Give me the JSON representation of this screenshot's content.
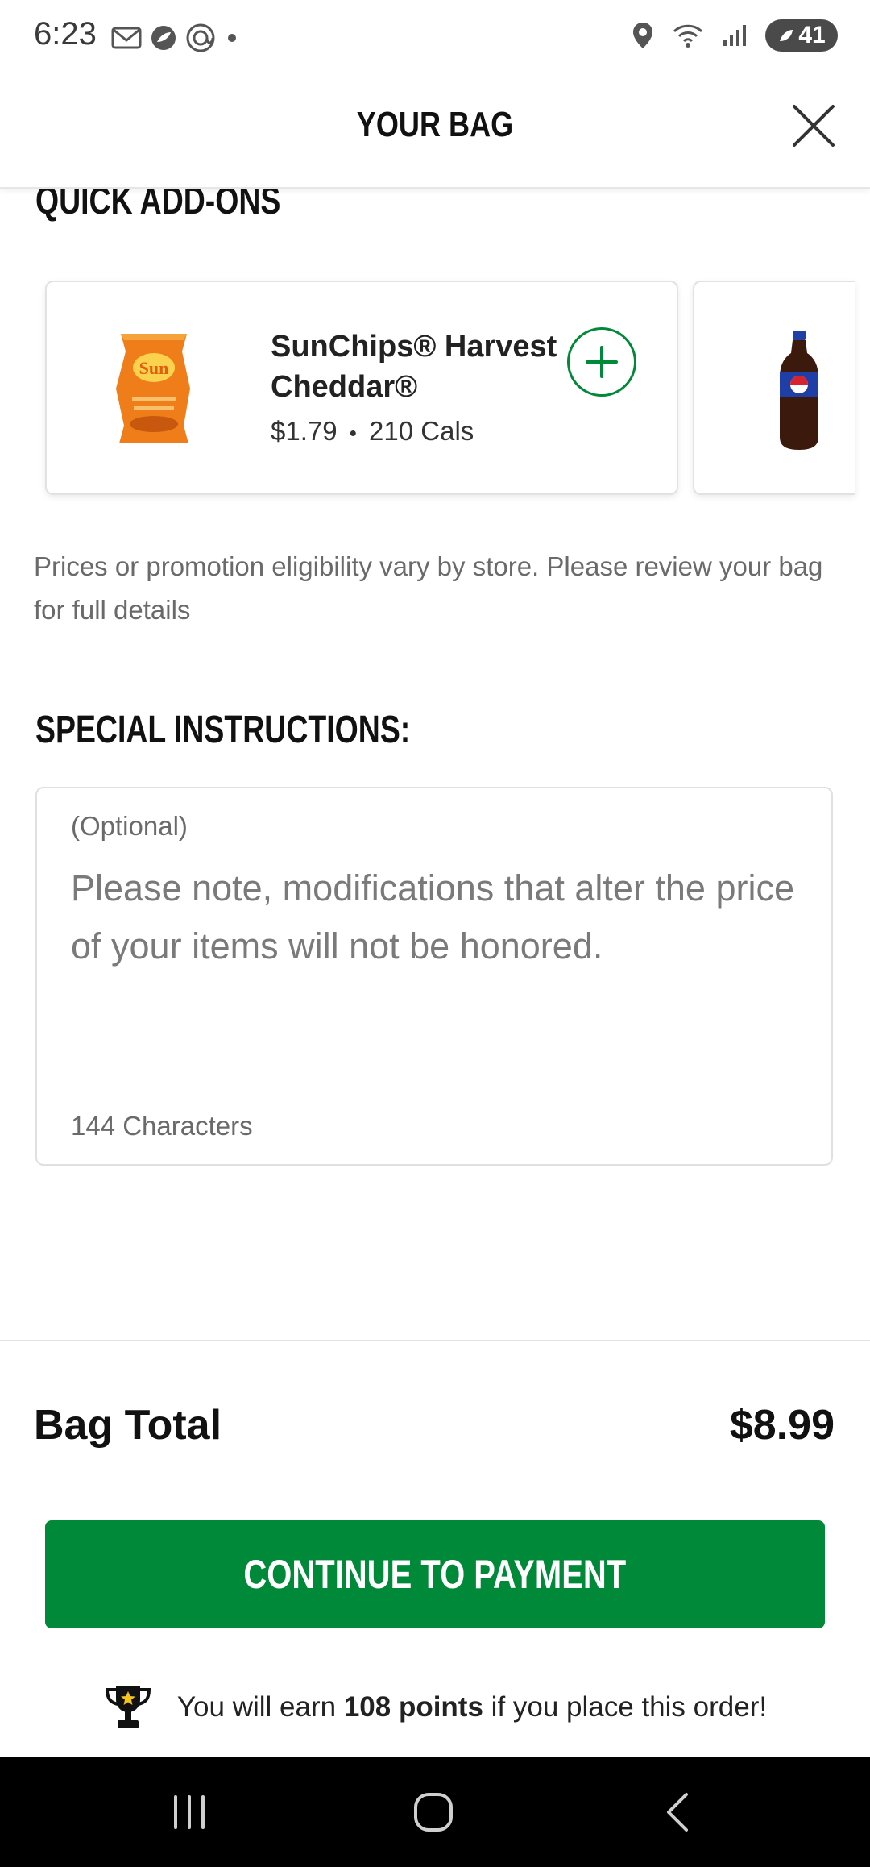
{
  "status_bar": {
    "time": "6:23",
    "battery": "41"
  },
  "header": {
    "title": "YOUR BAG"
  },
  "quick_addons": {
    "title": "QUICK ADD-ONS",
    "items": [
      {
        "name": "SunChips® Harvest Cheddar®",
        "price": "$1.79",
        "separator": "•",
        "calories": "210 Cals",
        "image": "sunchips-bag"
      },
      {
        "image": "pepsi-bottle"
      }
    ]
  },
  "disclaimer": "Prices or promotion eligibility vary by store. Please review your bag for full details",
  "special_instructions": {
    "title": "SPECIAL INSTRUCTIONS:",
    "optional_label": "(Optional)",
    "placeholder": "Please note, modifications that alter the price of your items will not be honored.",
    "char_count": "144 Characters"
  },
  "bag_total": {
    "label": "Bag Total",
    "value": "$8.99"
  },
  "continue_button": {
    "label": "CONTINUE TO PAYMENT"
  },
  "points": {
    "prefix": "You will earn",
    "amount": "108 points",
    "suffix": "if you place this order!"
  },
  "colors": {
    "brand_green": "#008938",
    "nav_bar": "#000000"
  }
}
